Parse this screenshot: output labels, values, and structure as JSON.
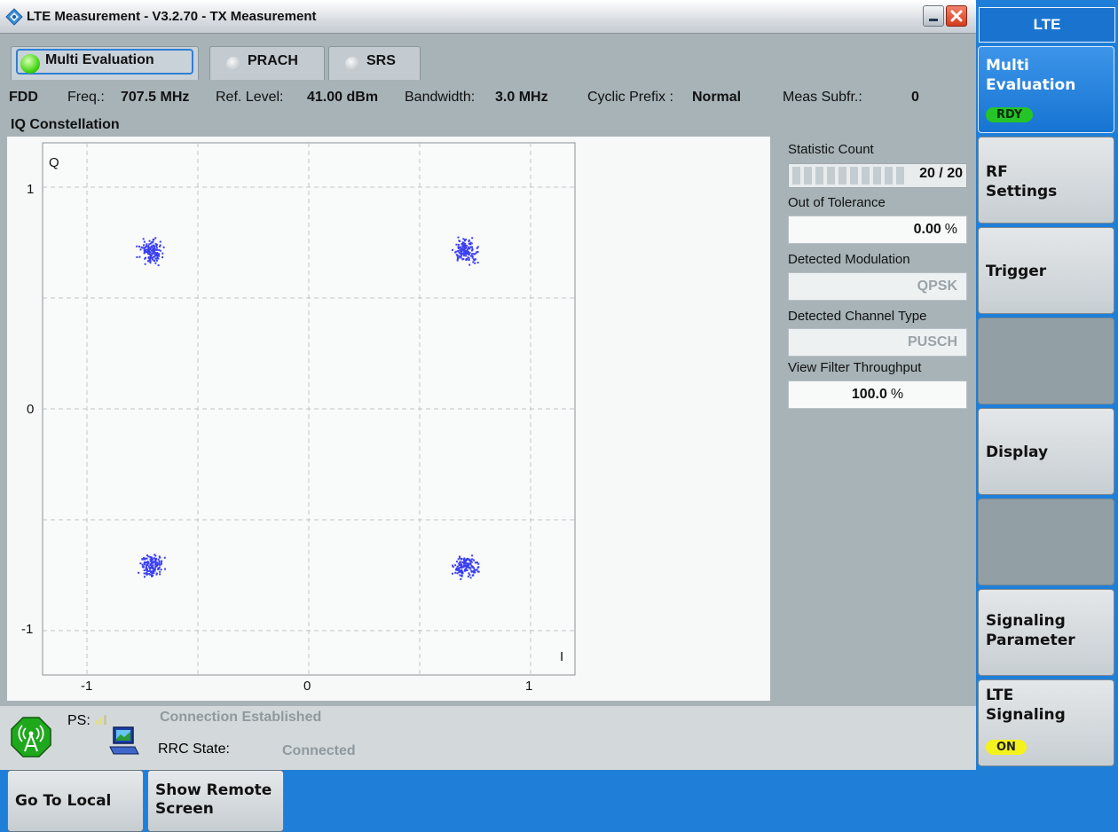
{
  "window": {
    "title": "LTE Measurement  - V3.2.70 - TX Measurement",
    "close_color": "#d43b1c"
  },
  "tabs": [
    {
      "label": "Multi Evaluation",
      "active": true
    },
    {
      "label": "PRACH",
      "active": false
    },
    {
      "label": "SRS",
      "active": false
    }
  ],
  "info": {
    "mode": "FDD",
    "freq_label": "Freq.:",
    "freq_value": "707.5 MHz",
    "ref_label": "Ref. Level:",
    "ref_value": "41.00 dBm",
    "bw_label": "Bandwidth:",
    "bw_value": "3.0 MHz",
    "cp_label": "Cyclic Prefix :",
    "cp_value": "Normal",
    "subfr_label": "Meas Subfr.:",
    "subfr_value": "0"
  },
  "section_title": "IQ Constellation",
  "chart_data": {
    "type": "scatter",
    "xlabel": "I",
    "ylabel": "Q",
    "xlim": [
      -1.2,
      1.2
    ],
    "ylim": [
      -1.2,
      1.2
    ],
    "xticks": [
      "-1",
      "0",
      "1"
    ],
    "yticks": [
      "1",
      "0",
      "-1"
    ],
    "xtick_values": [
      -1,
      0,
      1
    ],
    "ytick_values": [
      1,
      0,
      -1
    ],
    "grid": true,
    "grid_step": 0.5,
    "point_color": "#3a3ef2",
    "series": [
      {
        "center": [
          -0.71,
          0.71
        ],
        "spread": 0.045
      },
      {
        "center": [
          0.71,
          0.71
        ],
        "spread": 0.045
      },
      {
        "center": [
          -0.71,
          -0.71
        ],
        "spread": 0.045
      },
      {
        "center": [
          0.71,
          -0.71
        ],
        "spread": 0.045
      }
    ]
  },
  "stats": {
    "statistic_count_label": "Statistic Count",
    "statistic_count_value": "20 / 20",
    "statistic_count_progress": 1.0,
    "oot_label": "Out of Tolerance",
    "oot_value": "0.00",
    "oot_unit": "%",
    "modulation_label": "Detected Modulation",
    "modulation_value": "QPSK",
    "channel_label": "Detected Channel Type",
    "channel_value": "PUSCH",
    "throughput_label": "View Filter Throughput",
    "throughput_value": "100.0",
    "throughput_unit": "%"
  },
  "status": {
    "ps_label": "PS:",
    "connection_text": "Connection Established",
    "rrc_label": "RRC State:",
    "rrc_value": "Connected"
  },
  "softkeys": {
    "header": "LTE",
    "items": [
      {
        "label": "Multi\nEvaluation",
        "badge": "RDY"
      },
      {
        "label": "RF\nSettings"
      },
      {
        "label": "Trigger"
      },
      {
        "label": ""
      },
      {
        "label": "Display"
      },
      {
        "label": ""
      },
      {
        "label": "Signaling\nParameter"
      },
      {
        "label": "LTE\nSignaling",
        "badge": "ON"
      }
    ]
  },
  "bottom": {
    "go_local": "Go To Local",
    "remote_screen": "Show Remote\nScreen"
  }
}
